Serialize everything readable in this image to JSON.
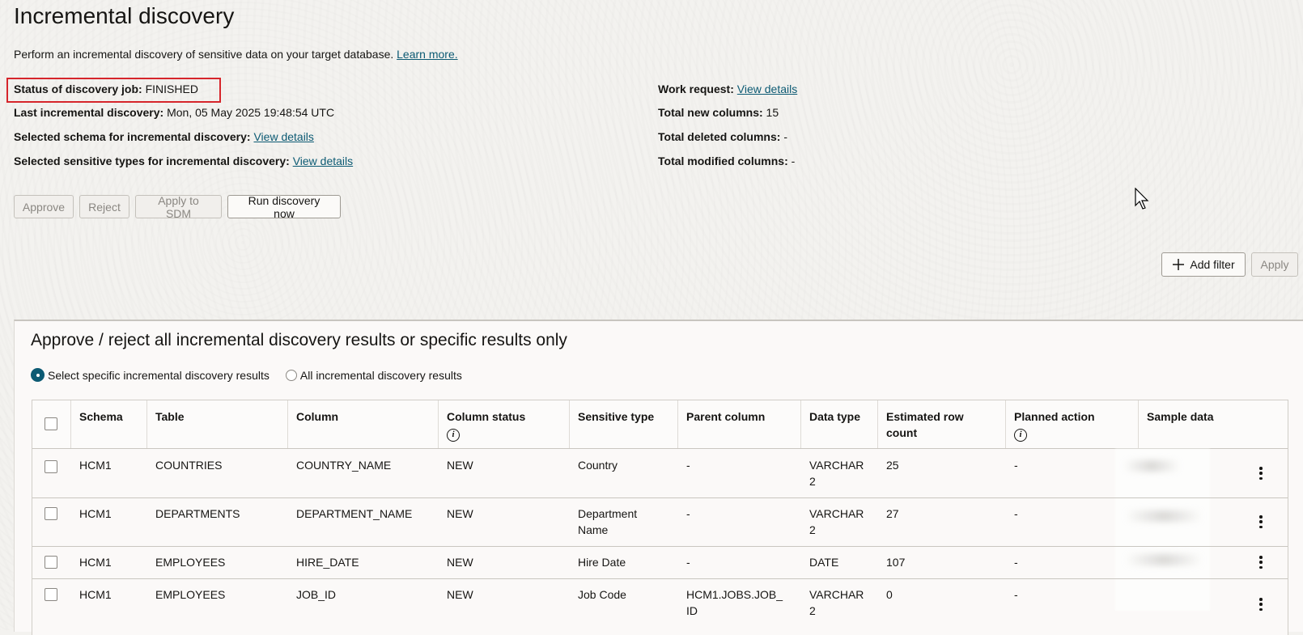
{
  "page": {
    "title": "Incremental discovery",
    "description": "Perform an incremental discovery of sensitive data on your target database.",
    "learn_more": "Learn more."
  },
  "summary_left": [
    {
      "label": "Status of discovery job:",
      "value": "FINISHED"
    },
    {
      "label": "Last incremental discovery:",
      "value": "Mon, 05 May 2025 19:48:54 UTC"
    },
    {
      "label": "Selected schema for incremental discovery:",
      "link": "View details"
    },
    {
      "label": "Selected sensitive types for incremental discovery:",
      "link": "View details"
    }
  ],
  "summary_right": [
    {
      "label": "Work request:",
      "link": "View details"
    },
    {
      "label": "Total new columns:",
      "value": "15"
    },
    {
      "label": "Total deleted columns:",
      "value": "-"
    },
    {
      "label": "Total modified columns:",
      "value": "-"
    }
  ],
  "actions": {
    "approve": "Approve",
    "reject": "Reject",
    "apply_sdm": "Apply to SDM",
    "run_now": "Run discovery now"
  },
  "filter": {
    "add_filter": "Add filter",
    "apply": "Apply"
  },
  "panel": {
    "title": "Approve / reject all incremental discovery results or specific results only",
    "radio_specific": "Select specific incremental discovery results",
    "radio_all": "All incremental discovery results",
    "selected": "specific"
  },
  "table": {
    "columns": [
      "Schema",
      "Table",
      "Column",
      "Column status",
      "Sensitive type",
      "Parent column",
      "Data type",
      "Estimated row count",
      "Planned action",
      "Sample data"
    ],
    "rows": [
      {
        "schema": "HCM1",
        "table": "COUNTRIES",
        "column": "COUNTRY_NAME",
        "status": "NEW",
        "type": "Country",
        "parent": "-",
        "data_type": "VARCHAR2",
        "rows": "25",
        "action": "-"
      },
      {
        "schema": "HCM1",
        "table": "DEPARTMENTS",
        "column": "DEPARTMENT_NAME",
        "status": "NEW",
        "type": "Department Name",
        "parent": "-",
        "data_type": "VARCHAR2",
        "rows": "27",
        "action": "-"
      },
      {
        "schema": "HCM1",
        "table": "EMPLOYEES",
        "column": "HIRE_DATE",
        "status": "NEW",
        "type": "Hire Date",
        "parent": "-",
        "data_type": "DATE",
        "rows": "107",
        "action": "-"
      },
      {
        "schema": "HCM1",
        "table": "EMPLOYEES",
        "column": "JOB_ID",
        "status": "NEW",
        "type": "Job Code",
        "parent": "HCM1.JOBS.JOB_ID",
        "data_type": "VARCHAR2",
        "rows": "0",
        "action": "-"
      }
    ]
  },
  "colors": {
    "link": "#0c5a73",
    "highlight_box": "#d6252b"
  }
}
